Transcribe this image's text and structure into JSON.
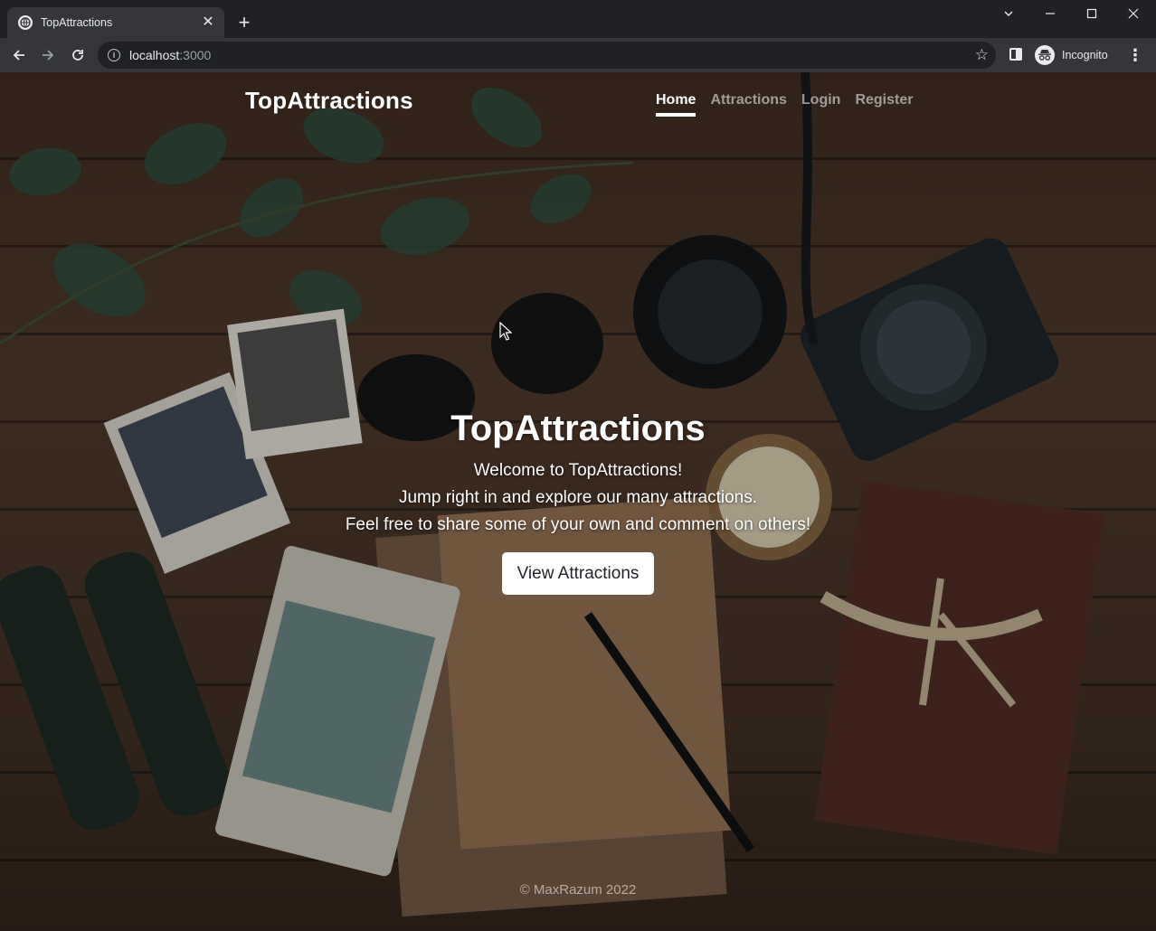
{
  "browser": {
    "tab": {
      "title": "TopAttractions",
      "close_icon": "close-icon",
      "favicon": "globe-icon"
    },
    "new_tab_icon": "plus-icon",
    "window_controls": {
      "tab_search": "chevron-down-icon",
      "minimize": "minimize-icon",
      "maximize": "maximize-icon",
      "close": "close-icon"
    },
    "address_bar": {
      "host": "localhost",
      "port": ":3000"
    },
    "incognito_label": "Incognito"
  },
  "navbar": {
    "brand": "TopAttractions",
    "links": [
      {
        "label": "Home",
        "active": true
      },
      {
        "label": "Attractions",
        "active": false
      },
      {
        "label": "Login",
        "active": false
      },
      {
        "label": "Register",
        "active": false
      }
    ]
  },
  "hero": {
    "title": "TopAttractions",
    "lines": [
      "Welcome to TopAttractions!",
      "Jump right in and explore our many attractions.",
      "Feel free to share some of your own and comment on others!"
    ],
    "button_label": "View Attractions"
  },
  "footer": {
    "text": "© MaxRazum 2022"
  },
  "colors": {
    "chrome_dark": "#202124",
    "chrome_toolbar": "#35363a",
    "text_light": "#e8eaed",
    "button_bg": "#ffffff"
  }
}
